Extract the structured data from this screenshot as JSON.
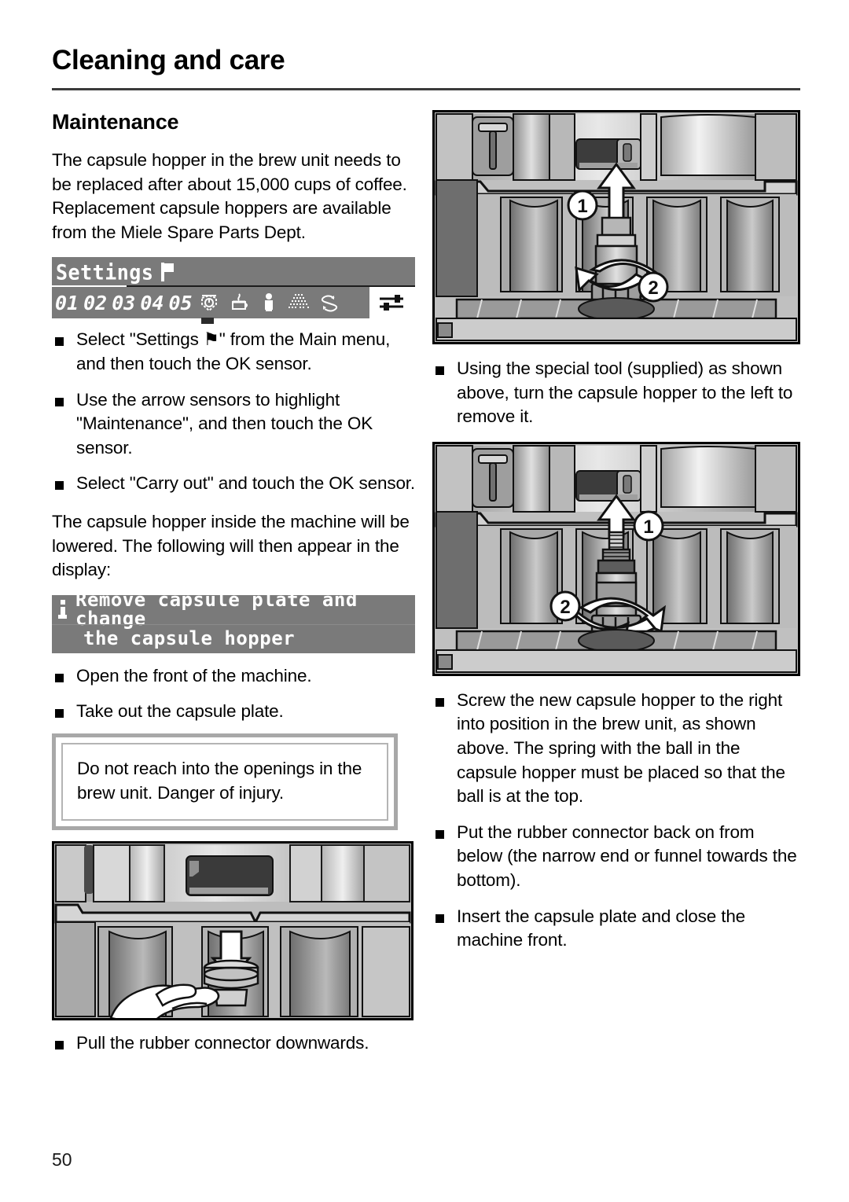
{
  "header": {
    "chapter_title": "Cleaning and care"
  },
  "left_column": {
    "section_title": "Maintenance",
    "intro_paragraph": "The capsule hopper in the brew unit needs to be replaced after about 15,000 cups of coffee. Replacement capsule hoppers are available from the Miele Spare Parts Dept.",
    "settings_display": {
      "title": "Settings",
      "title_icon": "flag-icon",
      "items": [
        "01",
        "02",
        "03",
        "04",
        "05"
      ],
      "icons": [
        "timer-icon",
        "cup-icon",
        "person-icon",
        "dots-grid-icon",
        "cycle-icon"
      ],
      "selected_icon": "sliders-icon"
    },
    "bullets_1": [
      "Select \"Settings ⚑\" from the Main menu, and then touch the OK sensor.",
      "Use the arrow sensors to highlight \"Maintenance\", and then touch the OK sensor.",
      "Select \"Carry out\" and touch the OK sensor."
    ],
    "paragraph_2": "The capsule hopper inside the machine will be lowered. The following will then appear in the display:",
    "info_display": {
      "icon": "info-icon",
      "line1": "Remove capsule plate and change",
      "line2": "the capsule hopper"
    },
    "bullets_2": [
      "Open the front of the machine.",
      "Take out the capsule plate."
    ],
    "warning": "Do not reach into the openings in the brew unit. Danger of injury.",
    "figure_hand": {
      "name": "brew-unit-rubber-connector-illustration",
      "callouts": []
    },
    "bullets_3": [
      "Pull the rubber connector downwards."
    ]
  },
  "right_column": {
    "figure_remove": {
      "name": "brew-unit-remove-hopper-illustration",
      "callouts": [
        "1",
        "2"
      ]
    },
    "bullets_1": [
      "Using the special tool (supplied) as shown above, turn the capsule hopper to the left to remove it."
    ],
    "figure_install": {
      "name": "brew-unit-install-hopper-illustration",
      "callouts": [
        "1",
        "2"
      ]
    },
    "bullets_2": [
      "Screw the new capsule hopper to the right into position in the brew unit, as shown above. The spring with the ball in the capsule hopper must be placed so that the ball is at the top.",
      "Put the rubber connector back on from below (the narrow end or funnel towards the bottom).",
      "Insert the capsule plate and close the machine front."
    ]
  },
  "footer": {
    "page_number": "50"
  },
  "colors": {
    "lcd_background": "#7a7a7a",
    "lcd_text": "#ffffff",
    "rule": "#3b3b3b",
    "warning_border": "#a8a8a8"
  }
}
